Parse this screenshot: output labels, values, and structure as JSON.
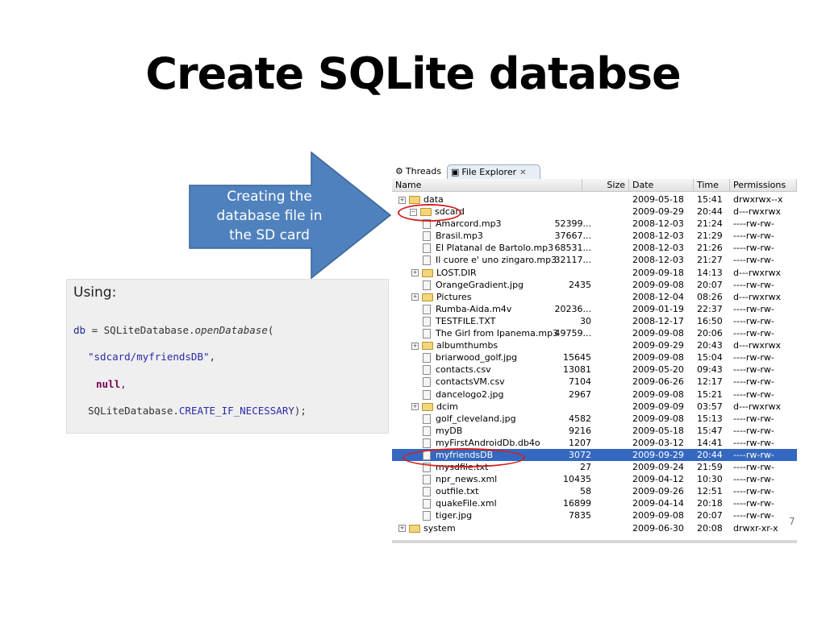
{
  "slide": {
    "title": "Create SQLite databse",
    "page_number": "7"
  },
  "callout": {
    "line1": "Creating the",
    "line2": "database file in",
    "line3": "the SD card",
    "color": "#4f81bd"
  },
  "code": {
    "heading": "Using:",
    "l1_var": "db",
    "l1_mid": " = SQLiteDatabase.",
    "l1_method": "openDatabase",
    "l1_end": "(",
    "l2_str": "\"sdcard/myfriendsDB\"",
    "l2_end": ",",
    "l3_kw": "null",
    "l3_end": ",",
    "l4_class": "SQLiteDatabase.",
    "l4_const": "CREATE_IF_NECESSARY",
    "l4_end": ");"
  },
  "explorer": {
    "tabs": {
      "threads": "Threads",
      "file_explorer": "File Explorer",
      "close": "✕"
    },
    "columns": {
      "name": "Name",
      "size": "Size",
      "date": "Date",
      "time": "Time",
      "permissions": "Permissions"
    },
    "rows": [
      {
        "name": "data",
        "size": "",
        "date": "2009-05-18",
        "time": "15:41",
        "perm": "drwxrwx--x"
      },
      {
        "name": "sdcard",
        "size": "",
        "date": "2009-09-29",
        "time": "20:44",
        "perm": "d---rwxrwx"
      },
      {
        "name": "Amarcord.mp3",
        "size": "52399...",
        "date": "2008-12-03",
        "time": "21:24",
        "perm": "----rw-rw-"
      },
      {
        "name": "Brasil.mp3",
        "size": "37667...",
        "date": "2008-12-03",
        "time": "21:29",
        "perm": "----rw-rw-"
      },
      {
        "name": "El Platanal de Bartolo.mp3",
        "size": "68531...",
        "date": "2008-12-03",
        "time": "21:26",
        "perm": "----rw-rw-"
      },
      {
        "name": "Il cuore e' uno zingaro.mp3",
        "size": "32117...",
        "date": "2008-12-03",
        "time": "21:27",
        "perm": "----rw-rw-"
      },
      {
        "name": "LOST.DIR",
        "size": "",
        "date": "2009-09-18",
        "time": "14:13",
        "perm": "d---rwxrwx"
      },
      {
        "name": "OrangeGradient.jpg",
        "size": "2435",
        "date": "2009-09-08",
        "time": "20:07",
        "perm": "----rw-rw-"
      },
      {
        "name": "Pictures",
        "size": "",
        "date": "2008-12-04",
        "time": "08:26",
        "perm": "d---rwxrwx"
      },
      {
        "name": "Rumba-Aida.m4v",
        "size": "20236...",
        "date": "2009-01-19",
        "time": "22:37",
        "perm": "----rw-rw-"
      },
      {
        "name": "TESTFILE.TXT",
        "size": "30",
        "date": "2008-12-17",
        "time": "16:50",
        "perm": "----rw-rw-"
      },
      {
        "name": "The Girl from Ipanema.mp3",
        "size": "49759...",
        "date": "2009-09-08",
        "time": "20:06",
        "perm": "----rw-rw-"
      },
      {
        "name": "albumthumbs",
        "size": "",
        "date": "2009-09-29",
        "time": "20:43",
        "perm": "d---rwxrwx"
      },
      {
        "name": "briarwood_golf.jpg",
        "size": "15645",
        "date": "2009-09-08",
        "time": "15:04",
        "perm": "----rw-rw-"
      },
      {
        "name": "contacts.csv",
        "size": "13081",
        "date": "2009-05-20",
        "time": "09:43",
        "perm": "----rw-rw-"
      },
      {
        "name": "contactsVM.csv",
        "size": "7104",
        "date": "2009-06-26",
        "time": "12:17",
        "perm": "----rw-rw-"
      },
      {
        "name": "dancelogo2.jpg",
        "size": "2967",
        "date": "2009-09-08",
        "time": "15:21",
        "perm": "----rw-rw-"
      },
      {
        "name": "dcim",
        "size": "",
        "date": "2009-09-09",
        "time": "03:57",
        "perm": "d---rwxrwx"
      },
      {
        "name": "golf_cleveland.jpg",
        "size": "4582",
        "date": "2009-09-08",
        "time": "15:13",
        "perm": "----rw-rw-"
      },
      {
        "name": "myDB",
        "size": "9216",
        "date": "2009-05-18",
        "time": "15:47",
        "perm": "----rw-rw-"
      },
      {
        "name": "myFirstAndroidDb.db4o",
        "size": "1207",
        "date": "2009-03-12",
        "time": "14:41",
        "perm": "----rw-rw-"
      },
      {
        "name": "myfriendsDB",
        "size": "3072",
        "date": "2009-09-29",
        "time": "20:44",
        "perm": "----rw-rw-"
      },
      {
        "name": "mysdfile.txt",
        "size": "27",
        "date": "2009-09-24",
        "time": "21:59",
        "perm": "----rw-rw-"
      },
      {
        "name": "npr_news.xml",
        "size": "10435",
        "date": "2009-04-12",
        "time": "10:30",
        "perm": "----rw-rw-"
      },
      {
        "name": "outfile.txt",
        "size": "58",
        "date": "2009-09-26",
        "time": "12:51",
        "perm": "----rw-rw-"
      },
      {
        "name": "quakeFile.xml",
        "size": "16899",
        "date": "2009-04-14",
        "time": "20:18",
        "perm": "----rw-rw-"
      },
      {
        "name": "tiger.jpg",
        "size": "7835",
        "date": "2009-09-08",
        "time": "20:07",
        "perm": "----rw-rw-"
      },
      {
        "name": "system",
        "size": "",
        "date": "2009-06-30",
        "time": "20:08",
        "perm": "drwxr-xr-x"
      }
    ]
  }
}
